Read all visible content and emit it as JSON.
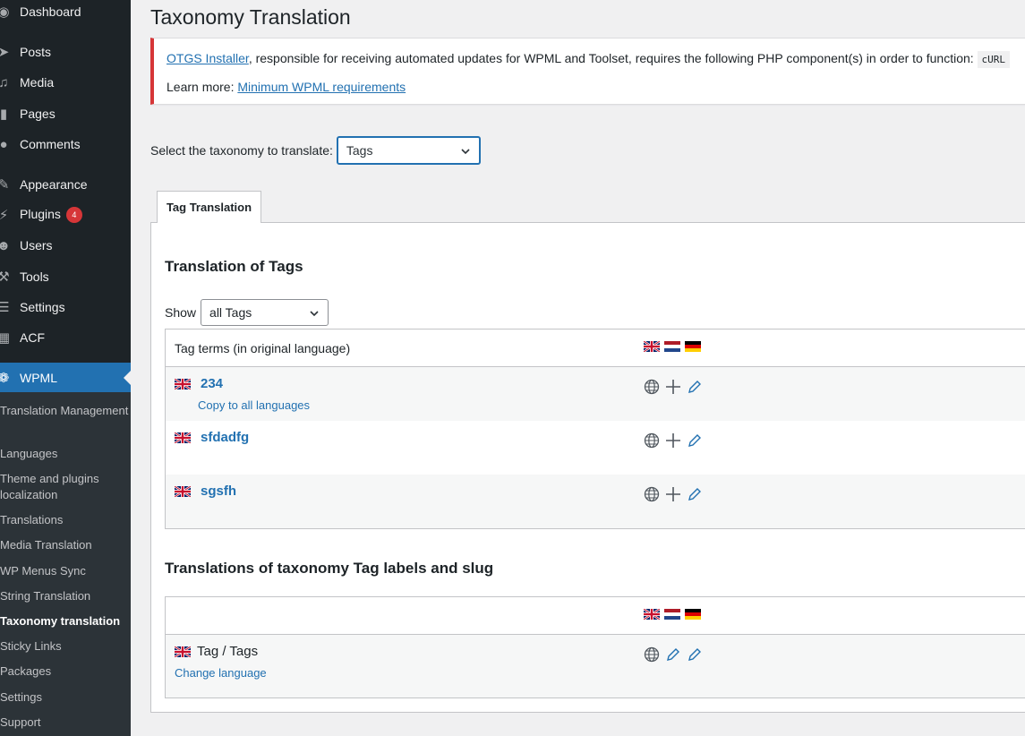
{
  "sidebar": {
    "menu": [
      {
        "name": "dashboard",
        "label": "Dashboard",
        "icon": "dashboard-icon"
      },
      {
        "name": "posts",
        "label": "Posts",
        "icon": "pin-icon"
      },
      {
        "name": "media",
        "label": "Media",
        "icon": "media-icon"
      },
      {
        "name": "pages",
        "label": "Pages",
        "icon": "pages-icon"
      },
      {
        "name": "comments",
        "label": "Comments",
        "icon": "comment-icon"
      },
      {
        "name": "appearance",
        "label": "Appearance",
        "icon": "brush-icon"
      },
      {
        "name": "plugins",
        "label": "Plugins",
        "icon": "plugin-icon",
        "badge": "4"
      },
      {
        "name": "users",
        "label": "Users",
        "icon": "user-icon"
      },
      {
        "name": "tools",
        "label": "Tools",
        "icon": "wrench-icon"
      },
      {
        "name": "settings",
        "label": "Settings",
        "icon": "settings-icon"
      },
      {
        "name": "acf",
        "label": "ACF",
        "icon": "grid-icon"
      },
      {
        "name": "wpml",
        "label": "WPML",
        "icon": "wpml-icon",
        "active": true
      }
    ],
    "submenu": [
      "Translation Management",
      "Languages",
      "Theme and plugins localization",
      "Translations",
      "Media Translation",
      "WP Menus Sync",
      "String Translation",
      "Taxonomy translation",
      "Sticky Links",
      "Packages",
      "Settings",
      "Support"
    ],
    "current_submenu": "Taxonomy translation"
  },
  "page": {
    "title": "Taxonomy Translation"
  },
  "notice": {
    "link1": "OTGS Installer",
    "text1": ", responsible for receiving automated updates for WPML and Toolset, requires the following PHP component(s) in order to function:",
    "code": "cURL",
    "learn_more": "Learn more:",
    "link2": "Minimum WPML requirements",
    "accent_color": "#d63638"
  },
  "taxonomy_select": {
    "label": "Select the taxonomy to translate:",
    "value": "Tags"
  },
  "tab": {
    "label": "Tag Translation"
  },
  "terms_section": {
    "title": "Translation of Tags",
    "show_label": "Show",
    "filter_value": "all Tags",
    "column_header": "Tag terms (in original language)",
    "languages": [
      "English",
      "Dutch",
      "German"
    ],
    "rows": [
      {
        "term": "234",
        "copy_link": "Copy to all languages"
      },
      {
        "term": "sfdadfg",
        "copy_link": ""
      },
      {
        "term": "sgsfh",
        "copy_link": ""
      }
    ]
  },
  "labels_section": {
    "title": "Translations of taxonomy Tag labels and slug",
    "row_label": "Tag / Tags",
    "change_language": "Change language"
  },
  "colors": {
    "sidebar_bg": "#1d2327",
    "accent": "#2271b1",
    "badge": "#d63638"
  }
}
